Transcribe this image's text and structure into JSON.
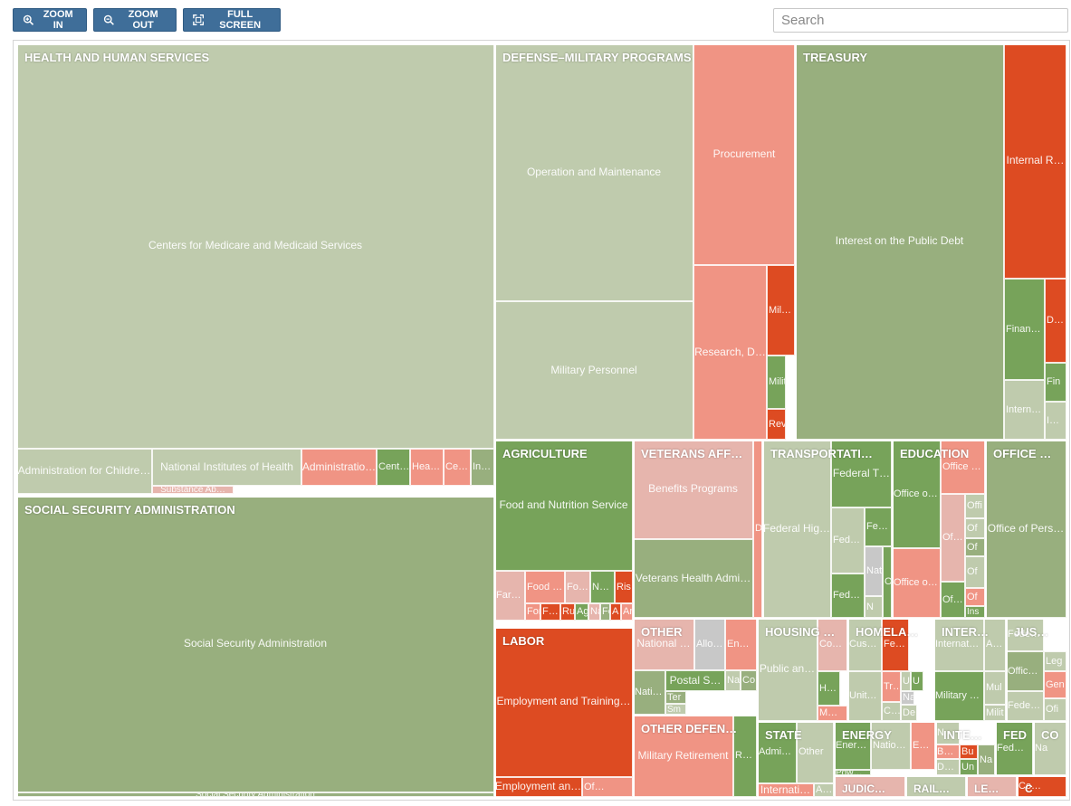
{
  "toolbar": {
    "zoom_in": "ZOOM IN",
    "zoom_out": "ZOOM OUT",
    "full_screen": "FULL SCREEN"
  },
  "search": {
    "placeholder": "Search"
  },
  "colors": {
    "light_green": "#bfcbad",
    "mid_green": "#98af7e",
    "dark_green": "#77a35a",
    "light_red": "#e6b5ad",
    "mid_red": "#f09484",
    "dark_red": "#dd4b22",
    "gray": "#c8c8c8"
  },
  "chart_data": {
    "type": "treemap",
    "groups": [
      {
        "name": "HEALTH AND HUMAN SERVICES",
        "items": [
          {
            "name": "Centers for Medicare and Medicaid Services",
            "color": "light_green"
          },
          {
            "name": "Administration for Childre…",
            "color": "light_green"
          },
          {
            "name": "National Institutes of Health",
            "color": "light_green"
          },
          {
            "name": "Substance Ab…",
            "color": "light_red"
          },
          {
            "name": "Administratio…",
            "color": "mid_red"
          },
          {
            "name": "Cent…",
            "color": "dark_green"
          },
          {
            "name": "Hea…",
            "color": "mid_red"
          },
          {
            "name": "Ce…",
            "color": "mid_red"
          },
          {
            "name": "In…",
            "color": "mid_green"
          }
        ]
      },
      {
        "name": "SOCIAL SECURITY ADMINISTRATION",
        "items": [
          {
            "name": "Social Security Administration",
            "color": "mid_green"
          },
          {
            "name": "Social Security Administration",
            "color": "mid_green"
          }
        ]
      },
      {
        "name": "DEFENSE–MILITARY PROGRAMS",
        "items": [
          {
            "name": "Operation and Maintenance",
            "color": "light_green"
          },
          {
            "name": "Military Personnel",
            "color": "light_green"
          },
          {
            "name": "Procurement",
            "color": "mid_red"
          },
          {
            "name": "Research, D…",
            "color": "mid_red"
          },
          {
            "name": "Mil…",
            "color": "dark_red"
          },
          {
            "name": "Milit",
            "color": "dark_green"
          },
          {
            "name": "Rev",
            "color": "dark_red"
          }
        ]
      },
      {
        "name": "TREASURY",
        "items": [
          {
            "name": "Interest on the Public Debt",
            "color": "mid_green"
          },
          {
            "name": "Internal R…",
            "color": "dark_red"
          },
          {
            "name": "Finan…",
            "color": "dark_green"
          },
          {
            "name": "D…",
            "color": "dark_red"
          },
          {
            "name": "Intern…",
            "color": "light_green"
          },
          {
            "name": "Fin",
            "color": "dark_green"
          },
          {
            "name": "I…",
            "color": "light_green"
          }
        ]
      },
      {
        "name": "AGRICULTURE",
        "items": [
          {
            "name": "Food and Nutrition Service",
            "color": "dark_green"
          },
          {
            "name": "Far…",
            "color": "light_red"
          },
          {
            "name": "Food …",
            "color": "mid_red"
          },
          {
            "name": "Fo…",
            "color": "light_red"
          },
          {
            "name": "N…",
            "color": "dark_green"
          },
          {
            "name": "Ris",
            "color": "dark_red"
          },
          {
            "name": "For",
            "color": "mid_red"
          },
          {
            "name": "F…",
            "color": "dark_red"
          },
          {
            "name": "Ru",
            "color": "dark_red"
          },
          {
            "name": "Ag",
            "color": "dark_green"
          },
          {
            "name": "Na",
            "color": "light_red"
          },
          {
            "name": "Fo",
            "color": "mid_green"
          },
          {
            "name": "A",
            "color": "dark_red"
          },
          {
            "name": "Ar",
            "color": "mid_red"
          }
        ]
      },
      {
        "name": "VETERANS AFF…",
        "items": [
          {
            "name": "Benefits Programs",
            "color": "light_red"
          },
          {
            "name": "Veterans Health Admi…",
            "color": "mid_green"
          },
          {
            "name": "D",
            "color": "mid_red"
          }
        ]
      },
      {
        "name": "TRANSPORTATI…",
        "items": [
          {
            "name": "Federal Hig…",
            "color": "light_green"
          },
          {
            "name": "Federal T…",
            "color": "dark_green"
          },
          {
            "name": "Fed…",
            "color": "light_green"
          },
          {
            "name": "Fe…",
            "color": "dark_green"
          },
          {
            "name": "Nat",
            "color": "gray"
          },
          {
            "name": "Fed…",
            "color": "dark_green"
          },
          {
            "name": "Offi",
            "color": "dark_green"
          },
          {
            "name": "N",
            "color": "light_green"
          }
        ]
      },
      {
        "name": "EDUCATION",
        "items": [
          {
            "name": "Office o…",
            "color": "dark_green"
          },
          {
            "name": "Office …",
            "color": "mid_red"
          },
          {
            "name": "Office o…",
            "color": "mid_red"
          },
          {
            "name": "Of…",
            "color": "light_red"
          },
          {
            "name": "Of…",
            "color": "dark_green"
          },
          {
            "name": "Offi",
            "color": "light_green"
          },
          {
            "name": "Of",
            "color": "light_green"
          },
          {
            "name": "Of",
            "color": "mid_green"
          },
          {
            "name": "Of",
            "color": "light_green"
          },
          {
            "name": "Of",
            "color": "mid_red"
          },
          {
            "name": "Ins",
            "color": "dark_green"
          }
        ]
      },
      {
        "name": "OFFICE …",
        "items": [
          {
            "name": "Office of Pers…",
            "color": "mid_green"
          }
        ]
      },
      {
        "name": "LABOR",
        "items": [
          {
            "name": "Employment and Training…",
            "color": "dark_red"
          },
          {
            "name": "Employment an…",
            "color": "dark_red"
          },
          {
            "name": "Of…",
            "color": "mid_red"
          }
        ]
      },
      {
        "name": "OTHER",
        "items": [
          {
            "name": "National …",
            "color": "light_red"
          },
          {
            "name": "Allo…",
            "color": "gray"
          },
          {
            "name": "En…",
            "color": "mid_red"
          },
          {
            "name": "Nati…",
            "color": "mid_green"
          },
          {
            "name": "Postal S…",
            "color": "dark_green"
          },
          {
            "name": "Nat",
            "color": "light_green"
          },
          {
            "name": "Co",
            "color": "mid_green"
          },
          {
            "name": "Ter",
            "color": "mid_green"
          },
          {
            "name": "Sm",
            "color": "light_green"
          }
        ]
      },
      {
        "name": "OTHER DEFEN…",
        "items": [
          {
            "name": "Military Retirement",
            "color": "mid_red"
          },
          {
            "name": "R…",
            "color": "dark_green"
          }
        ]
      },
      {
        "name": "HOUSING …",
        "items": [
          {
            "name": "Public an…",
            "color": "light_green"
          },
          {
            "name": "Co…",
            "color": "light_red"
          },
          {
            "name": "H…",
            "color": "dark_green"
          },
          {
            "name": "M…",
            "color": "mid_red"
          }
        ]
      },
      {
        "name": "HOMELA…",
        "items": [
          {
            "name": "Cus…",
            "color": "light_green"
          },
          {
            "name": "Fe…",
            "color": "dark_red"
          },
          {
            "name": "Unit…",
            "color": "light_green"
          },
          {
            "name": "Tr…",
            "color": "mid_red"
          },
          {
            "name": "U",
            "color": "light_green"
          },
          {
            "name": "U",
            "color": "dark_green"
          },
          {
            "name": "C…",
            "color": "light_green"
          },
          {
            "name": "Na",
            "color": "gray"
          },
          {
            "name": "De",
            "color": "light_green"
          }
        ]
      },
      {
        "name": "INTER…",
        "items": [
          {
            "name": "Internat…",
            "color": "light_green"
          },
          {
            "name": "A…",
            "color": "light_green"
          },
          {
            "name": "Military …",
            "color": "dark_green"
          },
          {
            "name": "Mul",
            "color": "light_green"
          },
          {
            "name": "Milit",
            "color": "light_green"
          }
        ]
      },
      {
        "name": "JUS…",
        "items": [
          {
            "name": "Fede…",
            "color": "light_green"
          },
          {
            "name": "Offic…",
            "color": "mid_green"
          },
          {
            "name": "Fede…",
            "color": "light_green"
          },
          {
            "name": "Leg",
            "color": "light_green"
          },
          {
            "name": "Gen",
            "color": "mid_red"
          },
          {
            "name": "Ofi",
            "color": "light_green"
          }
        ]
      },
      {
        "name": "STATE",
        "items": [
          {
            "name": "Admi…",
            "color": "dark_green"
          },
          {
            "name": "Other",
            "color": "light_green"
          },
          {
            "name": "Internati…",
            "color": "mid_red"
          },
          {
            "name": "A…",
            "color": "light_green"
          }
        ]
      },
      {
        "name": "ENERGY",
        "items": [
          {
            "name": "Ener…",
            "color": "dark_green"
          },
          {
            "name": "Natio…",
            "color": "light_green"
          },
          {
            "name": "E…",
            "color": "mid_red"
          },
          {
            "name": "Pow…",
            "color": "dark_green"
          }
        ]
      },
      {
        "name": "INTE…",
        "items": [
          {
            "name": "N",
            "color": "light_green"
          },
          {
            "name": "B…",
            "color": "mid_red"
          },
          {
            "name": "Bu",
            "color": "dark_red"
          },
          {
            "name": "Un",
            "color": "dark_green"
          },
          {
            "name": "Na",
            "color": "mid_green"
          },
          {
            "name": "D…",
            "color": "light_green"
          }
        ]
      },
      {
        "name": "FED",
        "items": [
          {
            "name": "Fed…",
            "color": "dark_green"
          }
        ]
      },
      {
        "name": "CO",
        "items": [
          {
            "name": "Na",
            "color": "light_green"
          }
        ]
      },
      {
        "name": "JUDIC…",
        "items": [
          {
            "name": "",
            "color": "light_red"
          }
        ]
      },
      {
        "name": "RAIL…",
        "items": [
          {
            "name": "",
            "color": "light_green"
          }
        ]
      },
      {
        "name": "LE…",
        "items": [
          {
            "name": "",
            "color": "light_red"
          }
        ]
      },
      {
        "name": "C",
        "items": [
          {
            "name": "Co…",
            "color": "dark_red"
          }
        ]
      }
    ]
  }
}
